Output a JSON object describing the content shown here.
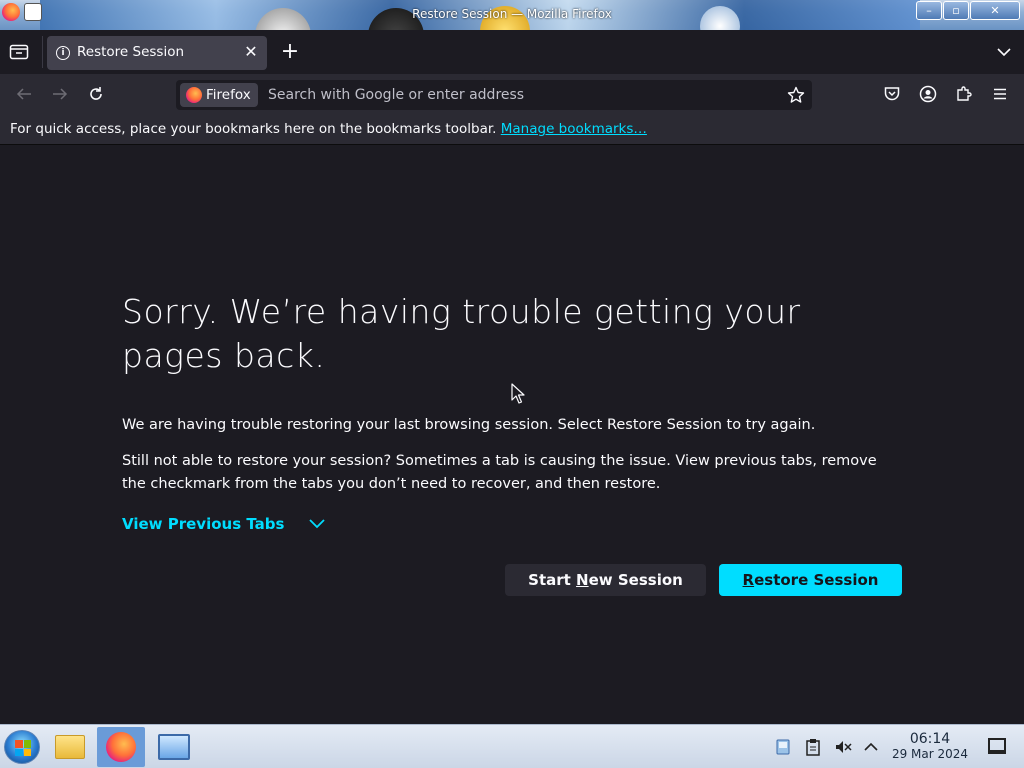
{
  "window": {
    "title": "Restore Session — Mozilla Firefox",
    "buttons": {
      "minimize": "–",
      "maximize": "▫",
      "close": "✕"
    }
  },
  "tabs": [
    {
      "title": "Restore Session",
      "icon": "info-icon",
      "active": true
    }
  ],
  "tabbar": {
    "new_tab": "+",
    "close_tab": "✕"
  },
  "navbar": {
    "identity_label": "Firefox",
    "search_placeholder": "Search with Google or enter address"
  },
  "bookmarks_toolbar": {
    "text": "For quick access, place your bookmarks here on the bookmarks toolbar.",
    "link": "Manage bookmarks…"
  },
  "page": {
    "headline": "Sorry. We’re having trouble getting your pages back.",
    "paragraph1": "We are having trouble restoring your last browsing session. Select Restore Session to try again.",
    "paragraph2": "Still not able to restore your session? Sometimes a tab is causing the issue. View previous tabs, remove the checkmark from the tabs you don’t need to recover, and then restore.",
    "view_previous_tabs": "View Previous Tabs",
    "start_new_session": {
      "before": "Start ",
      "key": "N",
      "after": "ew Session"
    },
    "restore_session": {
      "before": "",
      "key": "R",
      "after": "estore Session"
    }
  },
  "taskbar": {
    "clock_time": "06:14",
    "clock_date": "29 Mar 2024"
  },
  "colors": {
    "accent": "#00ddff",
    "page_background": "#1c1b22",
    "toolbar_background": "#2b2a33"
  }
}
